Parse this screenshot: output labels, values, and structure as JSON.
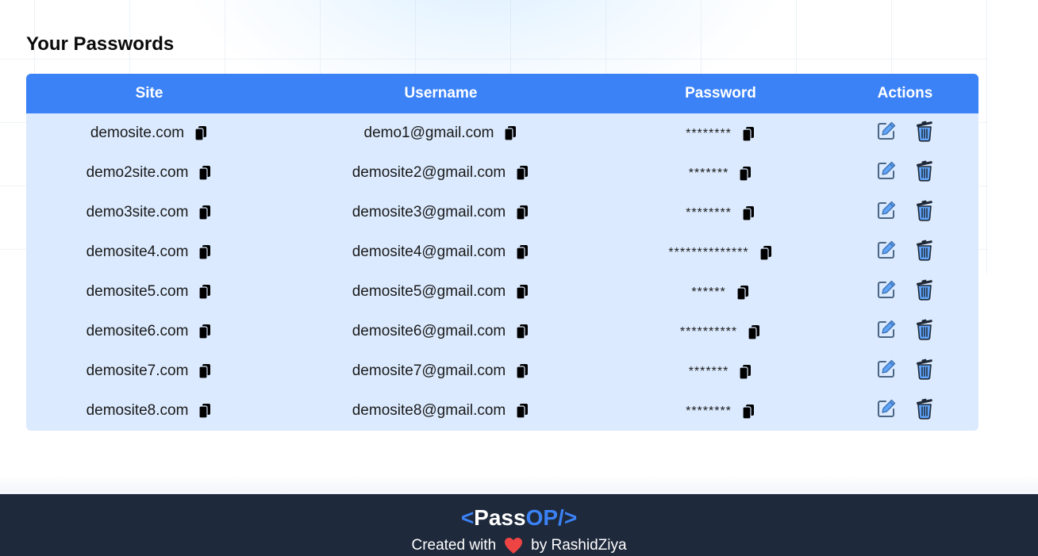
{
  "page": {
    "title": "Your Passwords"
  },
  "table": {
    "headers": {
      "site": "Site",
      "username": "Username",
      "password": "Password",
      "actions": "Actions"
    },
    "rows": [
      {
        "site": "demosite.com",
        "username": "demo1@gmail.com",
        "password": "********"
      },
      {
        "site": "demo2site.com",
        "username": "demosite2@gmail.com",
        "password": "*******"
      },
      {
        "site": "demo3site.com",
        "username": "demosite3@gmail.com",
        "password": "********"
      },
      {
        "site": "demosite4.com",
        "username": "demosite4@gmail.com",
        "password": "**************"
      },
      {
        "site": "demosite5.com",
        "username": "demosite5@gmail.com",
        "password": "******"
      },
      {
        "site": "demosite6.com",
        "username": "demosite6@gmail.com",
        "password": "**********"
      },
      {
        "site": "demosite7.com",
        "username": "demosite7@gmail.com",
        "password": "*******"
      },
      {
        "site": "demosite8.com",
        "username": "demosite8@gmail.com",
        "password": "********"
      }
    ],
    "icons": {
      "copy": "copy-icon",
      "edit": "edit-icon",
      "delete": "trash-icon"
    }
  },
  "footer": {
    "logo_open": "<",
    "logo_pass": "Pass",
    "logo_op": "OP/",
    "logo_close": ">",
    "credit_prefix": "Created with",
    "credit_suffix": "by RashidZiya",
    "heart_icon": "heart-icon"
  },
  "colors": {
    "accent": "#3b82f6",
    "row_bg": "#dbeafe",
    "footer_bg": "#1e293b",
    "heart": "#ef4444"
  }
}
